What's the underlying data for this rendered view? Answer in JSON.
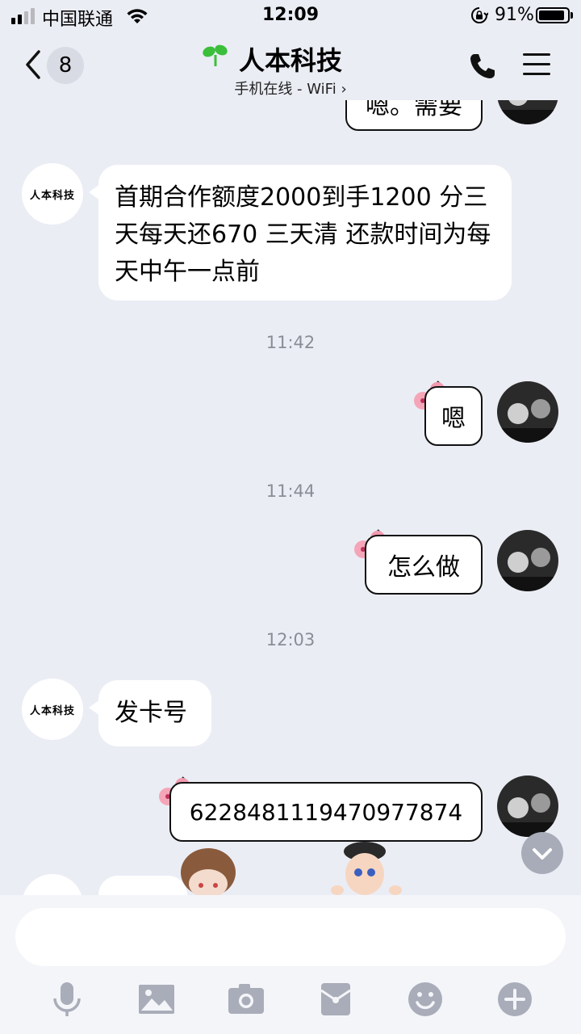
{
  "status_bar": {
    "carrier": "中国联通",
    "time": "12:09",
    "battery": "91%",
    "battery_level": 0.91,
    "icons": [
      "signal-icon",
      "wifi-icon",
      "rotation-lock-icon",
      "battery-icon"
    ]
  },
  "header": {
    "back_count": "8",
    "title": "人本科技",
    "subtitle": "手机在线 - WiFi",
    "icons": [
      "back-icon",
      "sprout-icon",
      "phone-icon",
      "menu-icon"
    ]
  },
  "messages": [
    {
      "side": "out",
      "text": "嗯。需要"
    },
    {
      "side": "in",
      "sender_logo": "人本科技",
      "text": "首期合作额度2000到手1200 分三天每天还670 三天清  还款时间为每天中午一点前"
    },
    {
      "type": "time",
      "text": "11:42"
    },
    {
      "side": "out",
      "text": "嗯"
    },
    {
      "type": "time",
      "text": "11:44"
    },
    {
      "side": "out",
      "text": "怎么做"
    },
    {
      "type": "time",
      "text": "12:03"
    },
    {
      "side": "in",
      "sender_logo": "人本科技",
      "text": "发卡号"
    },
    {
      "side": "out",
      "text": "6228481119470977874"
    }
  ],
  "composer": {
    "placeholder": "",
    "tools": [
      "microphone-icon",
      "image-icon",
      "camera-icon",
      "red-packet-icon",
      "emoji-icon",
      "plus-icon"
    ]
  },
  "colors": {
    "background": "#ebedf5",
    "bubble": "#ffffff",
    "timestamp": "#8a8d96",
    "toolbar_icon": "#a9adb9",
    "sprout": "#3bbf3b"
  }
}
